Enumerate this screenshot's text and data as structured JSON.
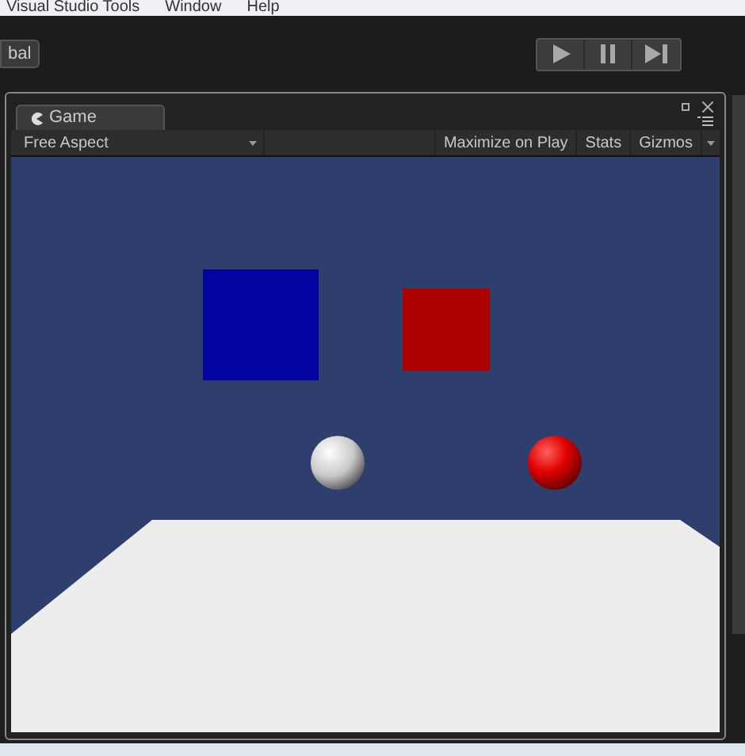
{
  "menu_bar": [
    "Visual Studio Tools",
    "Window",
    "Help"
  ],
  "toolbar": {
    "pivot_button": "bal"
  },
  "game_window": {
    "tabs": [
      {
        "label": "Game",
        "selected": true
      }
    ],
    "aspect_dropdown": "Free Aspect",
    "toggles": [
      {
        "label": "Maximize on Play",
        "on": false
      },
      {
        "label": "Stats",
        "on": false
      },
      {
        "label": "Gizmos",
        "on": false
      }
    ]
  }
}
